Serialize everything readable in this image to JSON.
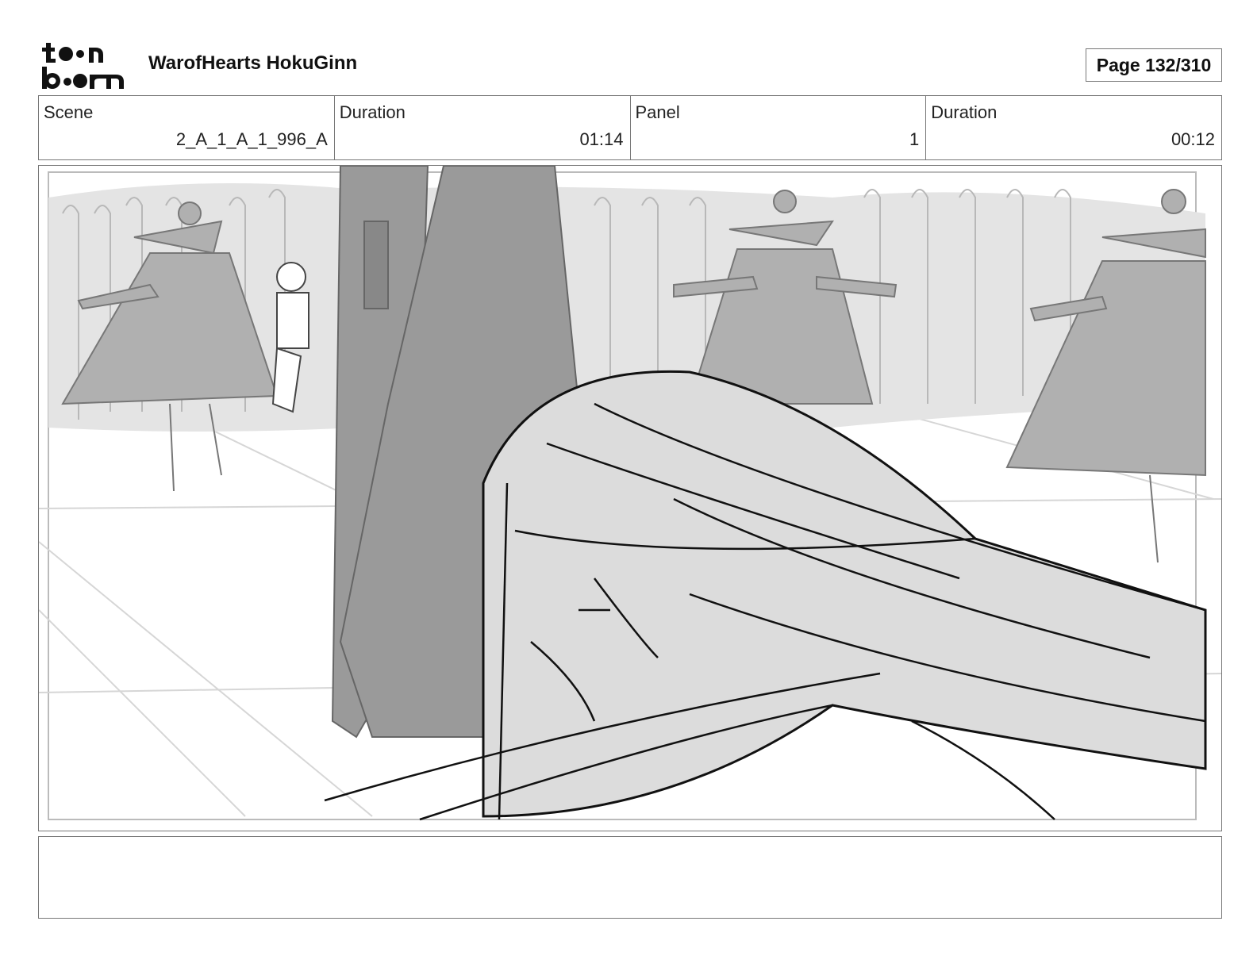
{
  "header": {
    "logo_text": "toonboom",
    "project_title": "WarofHearts HokuGinn",
    "page": "Page 132/310"
  },
  "info": {
    "scene_label": "Scene",
    "scene_value": "2_A_1_A_1_996_A",
    "scene_duration_label": "Duration",
    "scene_duration_value": "01:14",
    "panel_label": "Panel",
    "panel_value": "1",
    "panel_duration_label": "Duration",
    "panel_duration_value": "00:12"
  },
  "panel": {
    "image_icon": "storyboard-sketch"
  },
  "notes": {
    "text": ""
  }
}
